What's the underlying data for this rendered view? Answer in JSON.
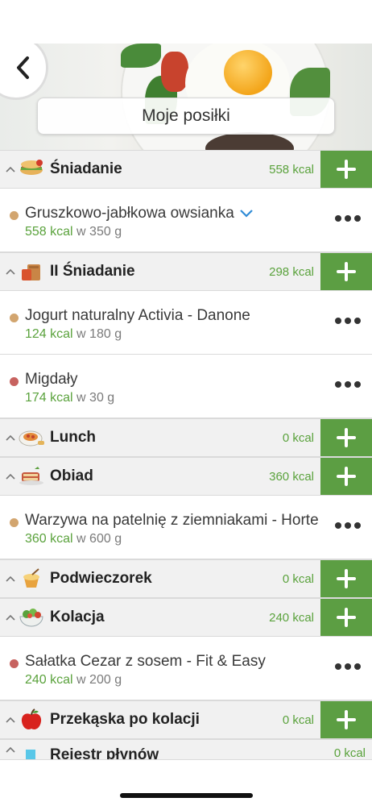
{
  "header": {
    "title": "Moje posiłki"
  },
  "colors": {
    "accent_green": "#5c9e43",
    "kcal_green": "#5aa23c",
    "dot_tan": "#d2a56f",
    "dot_red": "#c7625f"
  },
  "meals": [
    {
      "name": "Śniadanie",
      "icon": "sandwich-icon",
      "kcal": "558 kcal",
      "items": [
        {
          "name": "Gruszkowo-jabłkowa owsianka",
          "kcal": "558 kcal",
          "amount": "w 350 g",
          "dot": "tan",
          "expand": true
        }
      ]
    },
    {
      "name": "II Śniadanie",
      "icon": "lunchbag-icon",
      "kcal": "298 kcal",
      "items": [
        {
          "name": "Jogurt naturalny Activia - Danone",
          "kcal": "124 kcal",
          "amount": "w 180 g",
          "dot": "tan"
        },
        {
          "name": "Migdały",
          "kcal": "174 kcal",
          "amount": "w 30 g",
          "dot": "red"
        }
      ]
    },
    {
      "name": "Lunch",
      "icon": "pasta-icon",
      "kcal": "0 kcal",
      "items": []
    },
    {
      "name": "Obiad",
      "icon": "dinner-icon",
      "kcal": "360 kcal",
      "items": [
        {
          "name": "Warzywa na patelnię z ziemniakami - Horte",
          "kcal": "360 kcal",
          "amount": "w 600 g",
          "dot": "tan"
        }
      ]
    },
    {
      "name": "Podwieczorek",
      "icon": "dessert-icon",
      "kcal": "0 kcal",
      "items": []
    },
    {
      "name": "Kolacja",
      "icon": "salad-icon",
      "kcal": "240 kcal",
      "items": [
        {
          "name": "Sałatka Cezar z sosem - Fit & Easy",
          "kcal": "240 kcal",
          "amount": "w 200 g",
          "dot": "red"
        }
      ]
    },
    {
      "name": "Przekąska po kolacji",
      "icon": "apple-icon",
      "kcal": "0 kcal",
      "items": []
    },
    {
      "name": "Rejestr płynów",
      "icon": "water-icon",
      "kcal": "0 kcal",
      "items": []
    }
  ]
}
